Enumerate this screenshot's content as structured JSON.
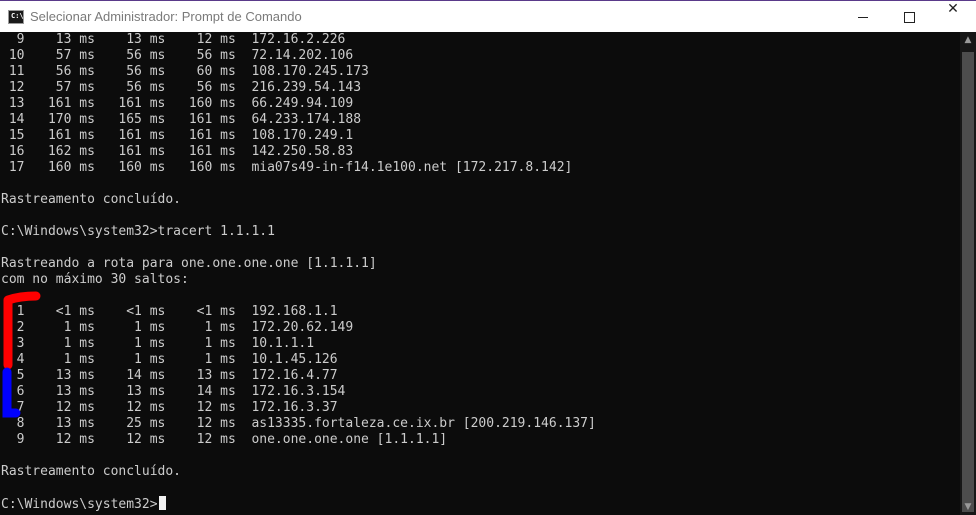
{
  "window": {
    "title": "Selecionar Administrador: Prompt de Comando",
    "icon_text": "C:\\",
    "minimize_glyph": "minimize-icon",
    "maximize_glyph": "maximize-icon",
    "close_glyph": "✕"
  },
  "console": {
    "lines": [
      "  9    13 ms    13 ms    12 ms  172.16.2.226",
      " 10    57 ms    56 ms    56 ms  72.14.202.106",
      " 11    56 ms    56 ms    60 ms  108.170.245.173",
      " 12    57 ms    56 ms    56 ms  216.239.54.143",
      " 13   161 ms   161 ms   160 ms  66.249.94.109",
      " 14   170 ms   165 ms   161 ms  64.233.174.188",
      " 15   161 ms   161 ms   161 ms  108.170.249.1",
      " 16   162 ms   161 ms   161 ms  142.250.58.83",
      " 17   160 ms   160 ms   160 ms  mia07s49-in-f14.1e100.net [172.217.8.142]",
      "",
      "Rastreamento concluído.",
      "",
      "C:\\Windows\\system32>tracert 1.1.1.1",
      "",
      "Rastreando a rota para one.one.one.one [1.1.1.1]",
      "com no máximo 30 saltos:",
      "",
      "  1    <1 ms    <1 ms    <1 ms  192.168.1.1",
      "  2     1 ms     1 ms     1 ms  172.20.62.149",
      "  3     1 ms     1 ms     1 ms  10.1.1.1",
      "  4     1 ms     1 ms     1 ms  10.1.45.126",
      "  5    13 ms    14 ms    13 ms  172.16.4.77",
      "  6    13 ms    13 ms    14 ms  172.16.3.154",
      "  7    12 ms    12 ms    12 ms  172.16.3.37",
      "  8    13 ms    25 ms    12 ms  as13335.fortaleza.ce.ix.br [200.219.146.137]",
      "  9    12 ms    12 ms    12 ms  one.one.one.one [1.1.1.1]",
      "",
      "Rastreamento concluído.",
      "",
      "C:\\Windows\\system32>"
    ]
  },
  "annotations": {
    "red_mark_color": "#ff0000",
    "blue_mark_color": "#0000ff"
  },
  "colors": {
    "console_bg": "#0c0c0c",
    "console_text": "#cccccc",
    "titlebar_bg": "#ffffff"
  }
}
